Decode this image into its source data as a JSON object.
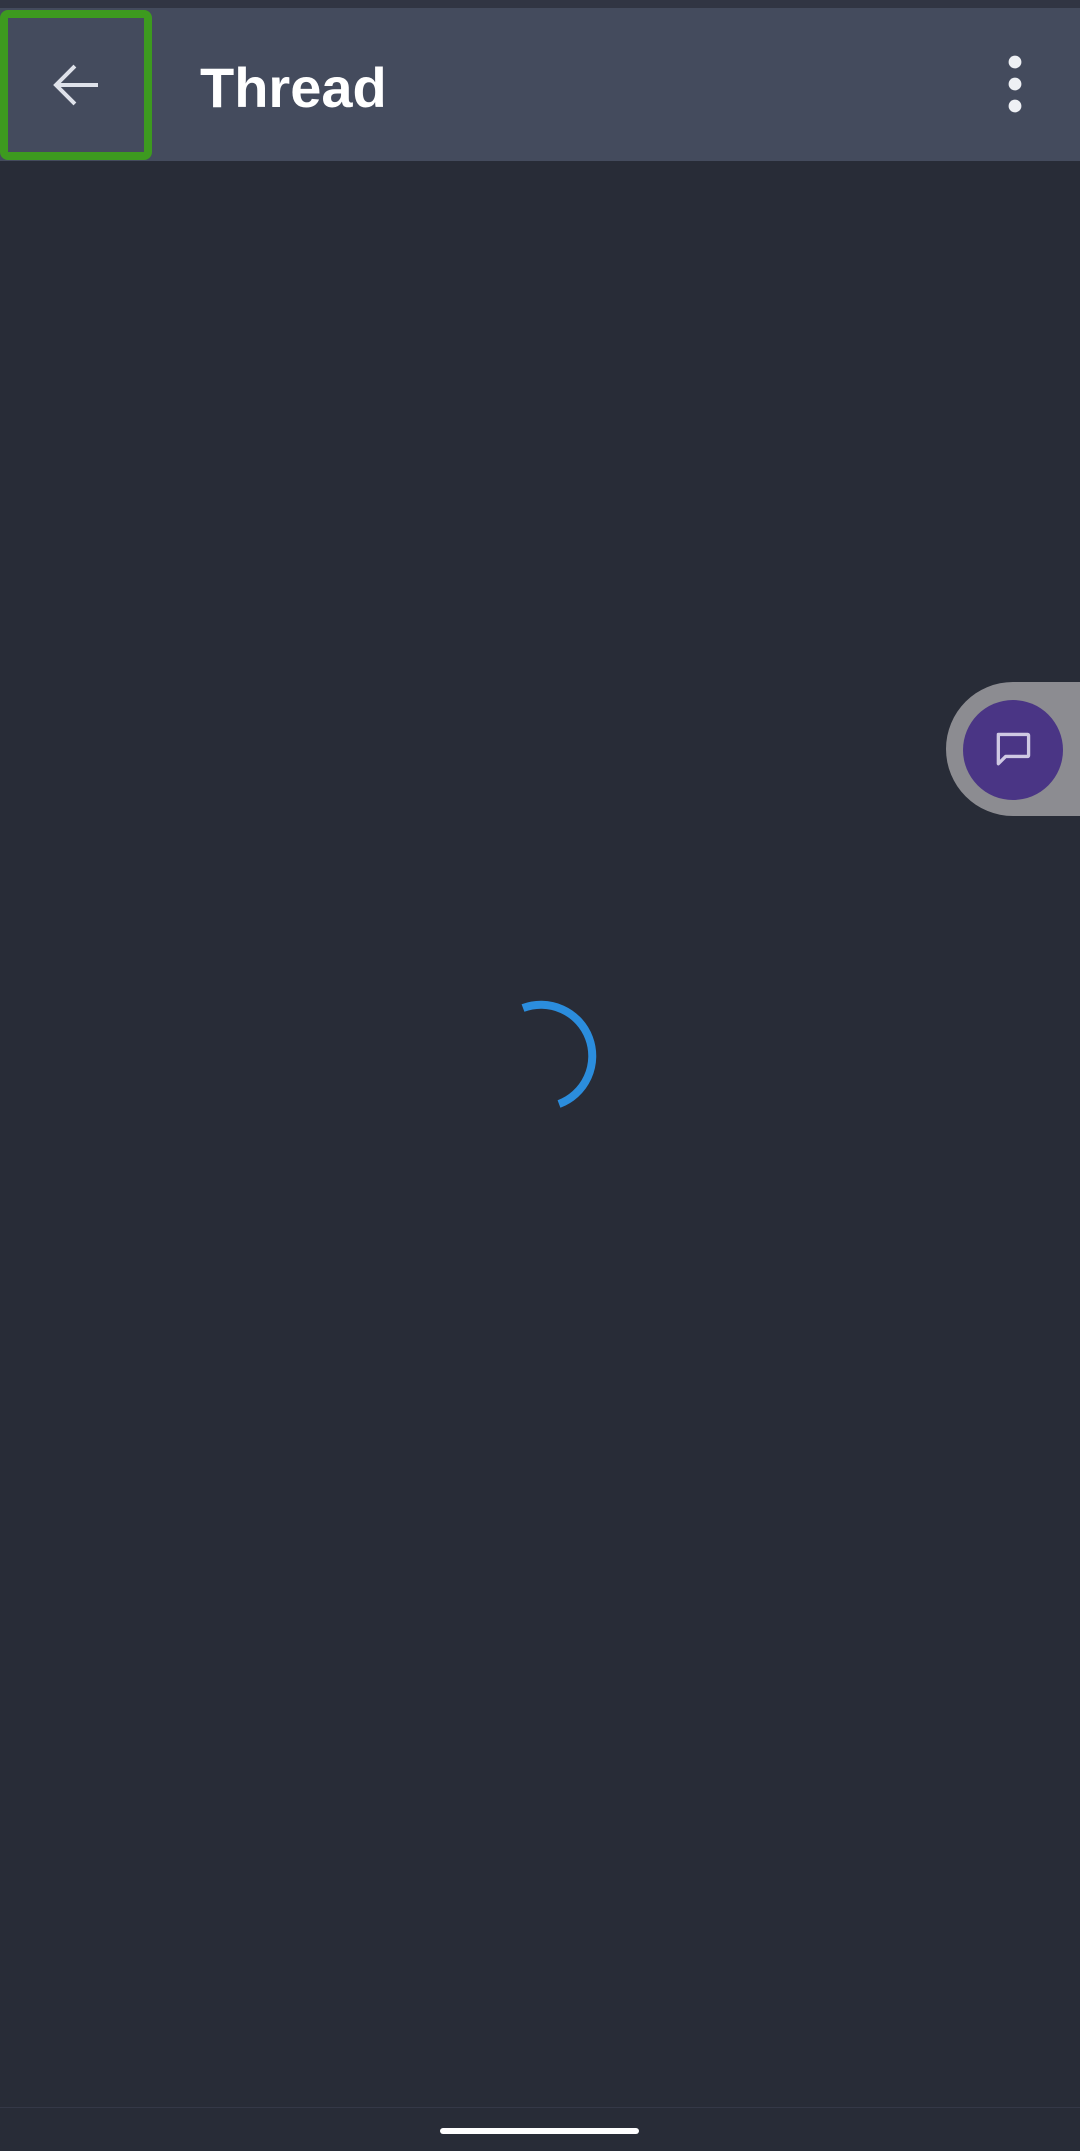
{
  "header": {
    "title": "Thread",
    "back_icon": "arrow-left-icon",
    "more_icon": "more-vertical-icon"
  },
  "main": {
    "state": "loading",
    "spinner_icon": "loading-spinner-icon"
  },
  "floating": {
    "chat_icon": "chat-bubble-icon"
  },
  "colors": {
    "background": "#282c37",
    "app_bar": "#444b5d",
    "highlight_border": "#3d9a1f",
    "spinner": "#2b8ddd",
    "fab": "#4a3585",
    "fab_tab": "#8c8c91"
  }
}
